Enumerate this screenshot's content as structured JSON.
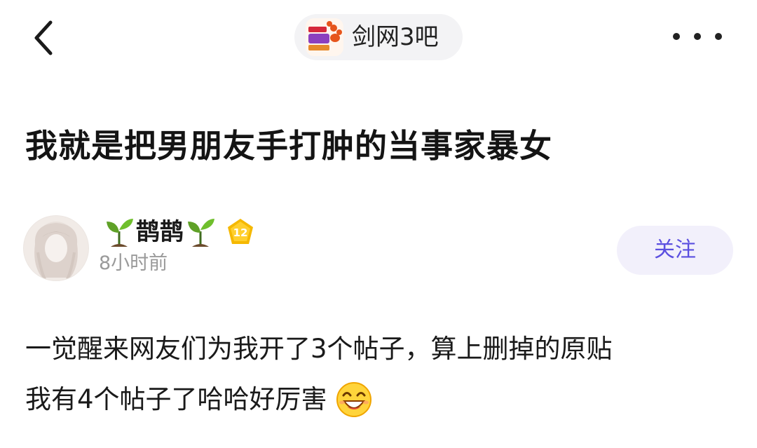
{
  "nav": {
    "back_icon": "chevron-left-icon",
    "forum_name": "剑网3吧",
    "more_icon": "more-horizontal-icon"
  },
  "post": {
    "title": "我就是把男朋友手打肿的当事家暴女",
    "author": {
      "prefix_icon": "sprout-icon",
      "name": "鹊鹊",
      "suffix_icon": "sprout-icon",
      "level": "12",
      "time": "8小时前"
    },
    "follow_label": "关注",
    "body_lines": [
      "一觉醒来网友们为我开了3个帖子，算上删掉的原贴",
      "我有4个帖子了哈哈好厉害"
    ],
    "body_emoji": "laughing-face-icon"
  },
  "colors": {
    "accent": "#5b4fe0",
    "follow_bg": "#f2f0fb",
    "pill_bg": "#f3f3f5",
    "muted_text": "#9a9a9a",
    "badge": "#f5b800"
  }
}
